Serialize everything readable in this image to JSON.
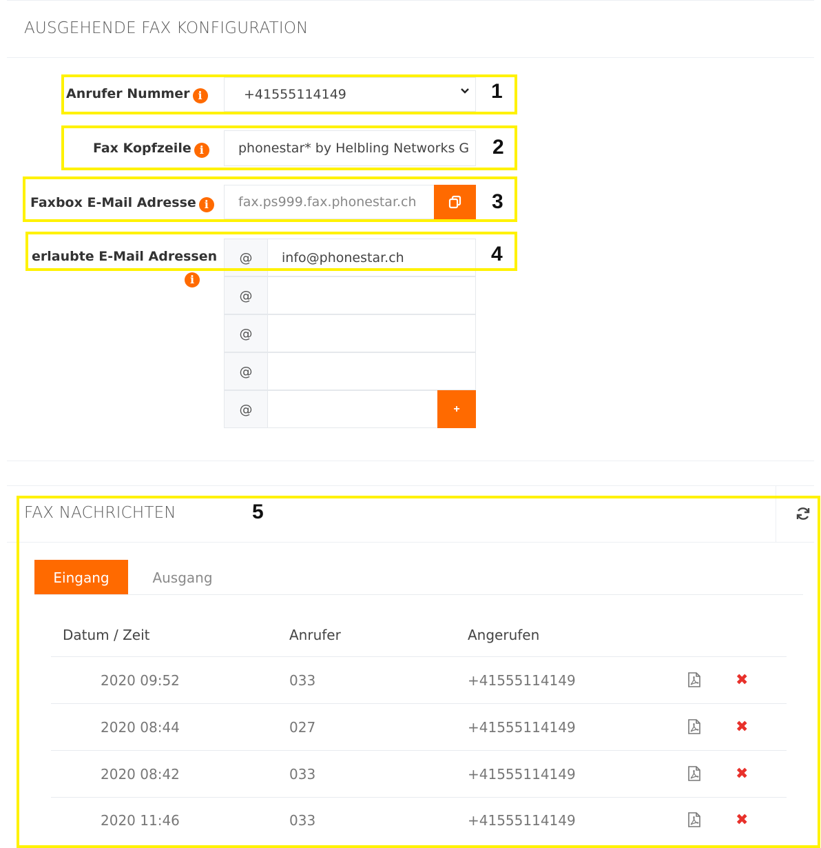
{
  "outgoing": {
    "title": "AUSGEHENDE FAX KONFIGURATION",
    "caller_number": {
      "label": "Anrufer Nummer",
      "value": "+41555114149"
    },
    "fax_header": {
      "label": "Fax Kopfzeile",
      "value": "phonestar* by Helbling Networks G"
    },
    "faxbox_email": {
      "label": "Faxbox E-Mail Adresse",
      "value": "fax.ps999.fax.phonestar.ch"
    },
    "allowed_emails": {
      "label": "erlaubte E-Mail Adressen",
      "prefix": "@",
      "values": [
        "info@phonestar.ch",
        "",
        "",
        "",
        ""
      ],
      "add_label": "+"
    },
    "info_glyph": "i"
  },
  "messages": {
    "title": "FAX NACHRICHTEN",
    "tabs": [
      {
        "label": "Eingang",
        "active": true
      },
      {
        "label": "Ausgang",
        "active": false
      }
    ],
    "columns": [
      "Datum / Zeit",
      "Anrufer",
      "Angerufen"
    ],
    "rows": [
      {
        "datetime": "2020 09:52",
        "caller": "033",
        "called": "+41555114149"
      },
      {
        "datetime": "2020 08:44",
        "caller": "027",
        "called": "+41555114149"
      },
      {
        "datetime": "2020 08:42",
        "caller": "033",
        "called": "+41555114149"
      },
      {
        "datetime": "2020 11:46",
        "caller": "033",
        "called": "+41555114149"
      }
    ],
    "delete_glyph": "✖"
  },
  "annotations": [
    "1",
    "2",
    "3",
    "4",
    "5"
  ],
  "colors": {
    "accent": "#ff6a00",
    "highlight": "#fff200",
    "delete": "#e8312b"
  },
  "icons": {
    "copy": "copy-icon",
    "refresh": "refresh-icon",
    "pdf": "pdf-icon",
    "info": "info-icon",
    "chevron": "chevron-down-icon"
  }
}
